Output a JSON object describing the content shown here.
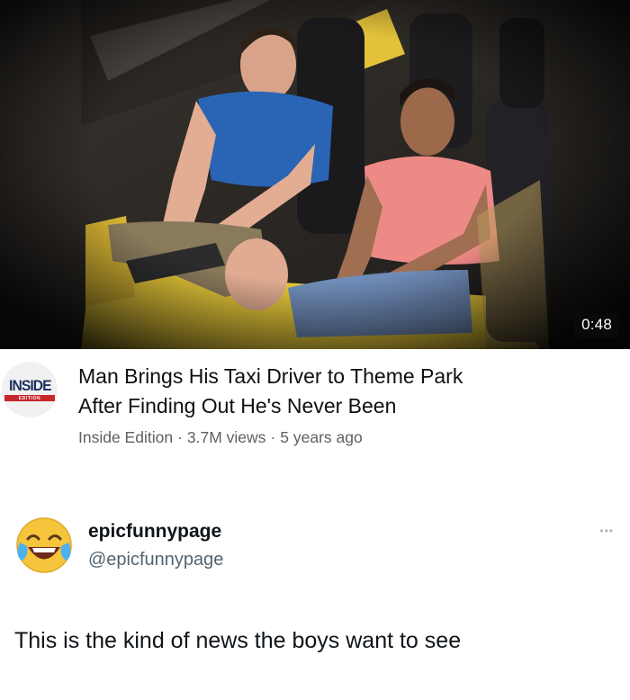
{
  "video": {
    "duration": "0:48",
    "title_line1": "Man Brings His Taxi Driver to Theme Park",
    "title_line2": "After Finding Out He's Never Been",
    "channel": "Inside Edition",
    "views": "3.7M views",
    "age": "5 years ago",
    "separator": "·",
    "channel_logo": {
      "word": "INSIDE",
      "band": "EDITION",
      "colors": {
        "navy": "#1d2f5e",
        "red": "#c9262c"
      }
    }
  },
  "tweet": {
    "display_name": "epicfunnypage",
    "username": "@epicfunnypage",
    "avatar_icon": "face-with-tears-of-joy-icon",
    "more_icon": "more-dots-icon",
    "text": "This is the kind of news the boys want to see"
  },
  "colors": {
    "secondary_text": "#606060",
    "handle_gray": "#536471",
    "ride_yellow": "#e8c93a"
  }
}
